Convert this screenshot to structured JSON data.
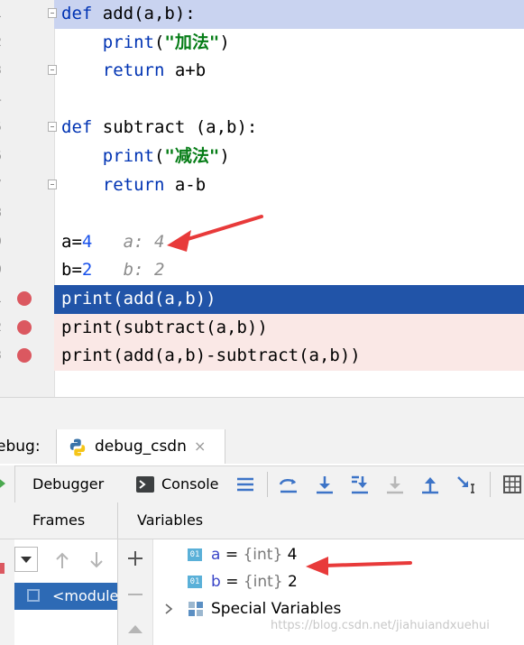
{
  "editor": {
    "lines": [
      {
        "no": "1",
        "parts": [
          {
            "t": "def",
            "c": "kw"
          },
          {
            "t": " add(a,b):",
            "c": ""
          }
        ],
        "bg": "#c9d3f0",
        "fold": true,
        "bp": false
      },
      {
        "no": "2",
        "parts": [
          {
            "t": "    ",
            "c": ""
          },
          {
            "t": "print",
            "c": "kw"
          },
          {
            "t": "(",
            "c": ""
          },
          {
            "t": "\"加法\"",
            "c": "str"
          },
          {
            "t": ")",
            "c": ""
          }
        ],
        "bg": "",
        "fold": false,
        "bp": false
      },
      {
        "no": "3",
        "parts": [
          {
            "t": "    ",
            "c": ""
          },
          {
            "t": "return",
            "c": "kw"
          },
          {
            "t": " a+b",
            "c": ""
          }
        ],
        "bg": "",
        "fold": true,
        "bp": false
      },
      {
        "no": "4",
        "parts": [],
        "bg": "",
        "fold": false,
        "bp": false
      },
      {
        "no": "5",
        "parts": [
          {
            "t": "def",
            "c": "kw"
          },
          {
            "t": " subtract (a,b):",
            "c": ""
          }
        ],
        "bg": "",
        "fold": true,
        "bp": false
      },
      {
        "no": "6",
        "parts": [
          {
            "t": "    ",
            "c": ""
          },
          {
            "t": "print",
            "c": "kw"
          },
          {
            "t": "(",
            "c": ""
          },
          {
            "t": "\"减法\"",
            "c": "str"
          },
          {
            "t": ")",
            "c": ""
          }
        ],
        "bg": "",
        "fold": false,
        "bp": false
      },
      {
        "no": "7",
        "parts": [
          {
            "t": "    ",
            "c": ""
          },
          {
            "t": "return",
            "c": "kw"
          },
          {
            "t": " a-b",
            "c": ""
          }
        ],
        "bg": "",
        "fold": true,
        "bp": false
      },
      {
        "no": "8",
        "parts": [],
        "bg": "",
        "fold": false,
        "bp": false
      },
      {
        "no": "9",
        "parts": [
          {
            "t": "a=",
            "c": ""
          },
          {
            "t": "4",
            "c": "num"
          },
          {
            "t": "   a: 4",
            "c": "hint"
          }
        ],
        "bg": "",
        "fold": false,
        "bp": false
      },
      {
        "no": "0",
        "parts": [
          {
            "t": "b=",
            "c": ""
          },
          {
            "t": "2",
            "c": "num"
          },
          {
            "t": "   b: 2",
            "c": "hint"
          }
        ],
        "bg": "",
        "fold": false,
        "bp": false
      },
      {
        "no": "1",
        "parts": [
          {
            "t": "print(add(a,b))",
            "c": ""
          }
        ],
        "bg": "#2154a8",
        "fg": "#ffffff",
        "fold": false,
        "bp": true
      },
      {
        "no": "2",
        "parts": [
          {
            "t": "print(subtract(a,b))",
            "c": ""
          }
        ],
        "bg": "#fae8e6",
        "fold": false,
        "bp": true
      },
      {
        "no": "3",
        "parts": [
          {
            "t": "print(add(a,b)-subtract(a,b))",
            "c": ""
          }
        ],
        "bg": "#fae8e6",
        "fold": false,
        "bp": true
      }
    ]
  },
  "debug": {
    "title": "ebug:",
    "tab_label": "debug_csdn",
    "close_glyph": "×",
    "toolbar": {
      "debugger_label": "Debugger",
      "console_label": "Console"
    },
    "frames_label": "Frames",
    "variables_label": "Variables",
    "module_label": "<module",
    "variables": [
      {
        "badge": "01",
        "name": "a",
        "eq": " = ",
        "type": "{int}",
        "value": " 4"
      },
      {
        "badge": "01",
        "name": "b",
        "eq": " = ",
        "type": "{int}",
        "value": " 2"
      }
    ],
    "special_label": "Special Variables",
    "watermark": "https://blog.csdn.net/jiahuiandxuehui"
  },
  "colors": {
    "breakpoint": "#db5860",
    "current_line": "#2154a8",
    "keyword": "#0033b3",
    "arrow": "#e83a3a"
  }
}
